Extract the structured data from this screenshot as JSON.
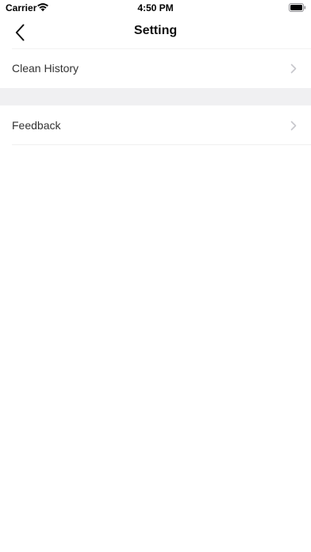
{
  "status_bar": {
    "carrier": "Carrier",
    "time": "4:50 PM"
  },
  "nav": {
    "title": "Setting",
    "back_icon": "chevron-left-icon"
  },
  "settings": {
    "items": [
      {
        "label": "Clean History",
        "icon": "chevron-right-icon"
      },
      {
        "label": "Feedback",
        "icon": "chevron-right-icon"
      }
    ]
  },
  "colors": {
    "background": "#ffffff",
    "section_gap": "#f0f0f2",
    "divider": "#efefef",
    "chevron": "#c7c7cc",
    "text": "#333333"
  }
}
